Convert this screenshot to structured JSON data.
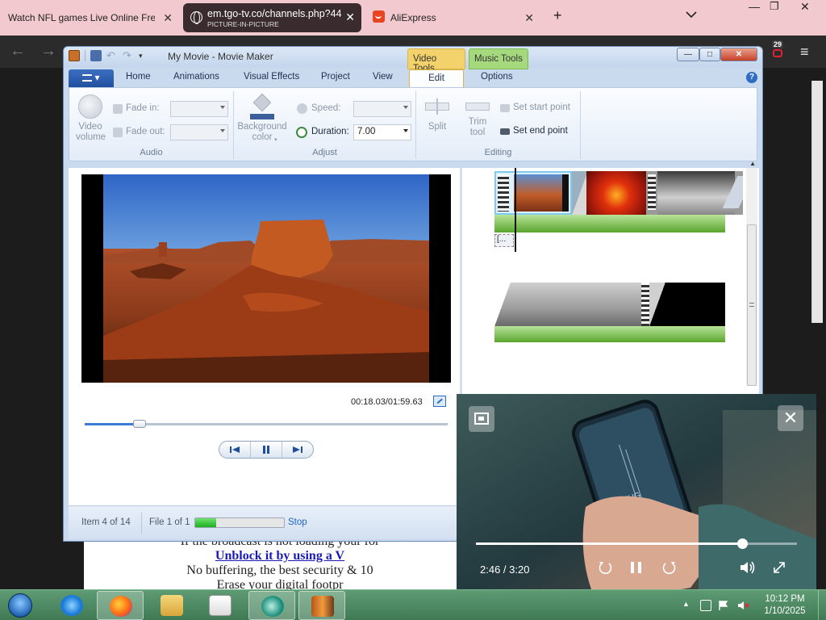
{
  "browser": {
    "tabs": [
      {
        "title": "Watch NFL games Live Online Free",
        "subtitle": "",
        "icon": "",
        "active": false
      },
      {
        "title": "em.tgo-tv.co/channels.php?44",
        "subtitle": "PICTURE-IN-PICTURE",
        "icon": "globe-icon",
        "active": true
      },
      {
        "title": "AliExpress",
        "subtitle": "",
        "icon": "aliexpress-icon",
        "active": false
      }
    ],
    "new_tab": "+",
    "tab_menu": "⌄",
    "window_controls": {
      "minimize": "—",
      "maximize": "❐",
      "close": "✕"
    },
    "nav": {
      "back": "←",
      "forward": "→"
    },
    "extension_badge": "29",
    "menu": "≡"
  },
  "webpage": {
    "line1": "If the broadcast is not loading your for",
    "link": "Unblock it by using a V",
    "line3": "No buffering, the best security & 10",
    "line4": "Erase your digital footpr"
  },
  "moviemaker": {
    "title": "My Movie - Movie Maker",
    "context_tabs": {
      "video": "Video Tools",
      "music": "Music Tools"
    },
    "window_controls": {
      "minimize": "—",
      "maximize": "□",
      "close": "✕"
    },
    "file_menu": "▾",
    "tabs": [
      "Home",
      "Animations",
      "Visual Effects",
      "Project",
      "View",
      "Edit",
      "Options"
    ],
    "active_tab": "Edit",
    "help": "?",
    "ribbon": {
      "audio": {
        "label": "Audio",
        "video_volume": "Video\nvolume",
        "fade_in": "Fade in:",
        "fade_out": "Fade out:"
      },
      "adjust": {
        "label": "Adjust",
        "background_color": "Background\ncolor",
        "speed": "Speed:",
        "duration": "Duration:",
        "duration_value": "7.00"
      },
      "editing": {
        "label": "Editing",
        "split": "Split",
        "trim_tool": "Trim\ntool",
        "set_start_point": "Set start point",
        "set_end_point": "Set end point"
      }
    },
    "preview": {
      "timecode": "00:18.03/01:59.63",
      "seek_fraction": 0.151
    },
    "storyboard": {
      "caption_chip": "[..."
    },
    "status": {
      "item": "Item 4 of 14",
      "file": "File 1 of 1",
      "progress_fraction": 0.24,
      "stop": "Stop"
    }
  },
  "pip": {
    "time": "2:46 / 3:20",
    "progress_fraction": 0.83,
    "close": "✕"
  },
  "taskbar": {
    "clock_time": "10:12 PM",
    "clock_date": "1/10/2025",
    "tray_up": "▲"
  },
  "colors": {
    "tabbar": "#f1c9ce",
    "active_tab": "#3a2c2e",
    "taskbar": "#4f8a63",
    "ribbon_accent": "#2f6cc4",
    "progress_green": "#3cc43c"
  }
}
